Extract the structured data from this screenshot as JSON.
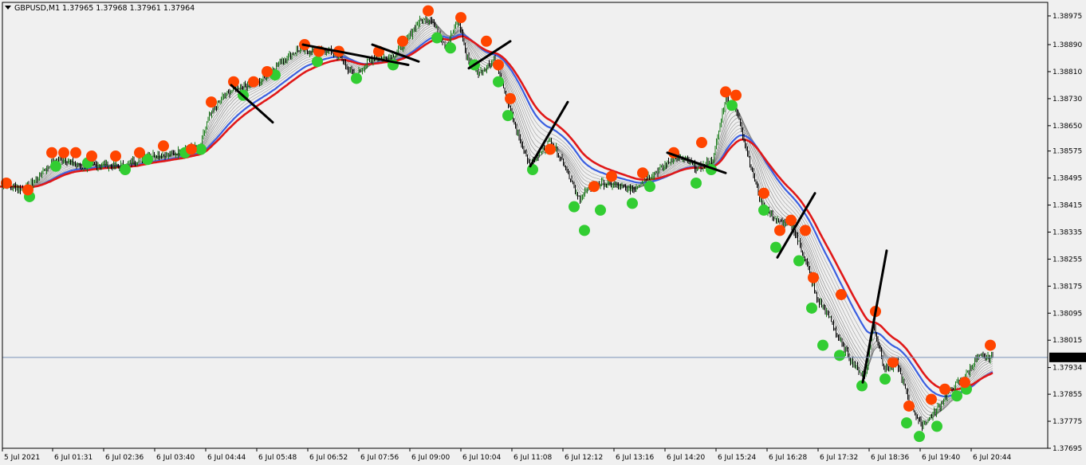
{
  "header": {
    "symbol_label": "GBPUSD,M1",
    "ohlc_text": "1.37965 1.37968 1.37961 1.37964"
  },
  "chart_data": {
    "type": "candlestick",
    "symbol": "GBPUSD",
    "timeframe": "M1",
    "ohlc": {
      "open": 1.37965,
      "high": 1.37968,
      "low": 1.37961,
      "close": 1.37964
    },
    "current_price": 1.37964,
    "current_price_label": "1.37964",
    "ylim": [
      1.37695,
      1.39015
    ],
    "y_ticks": [
      "1.38975",
      "1.38890",
      "1.38810",
      "1.38730",
      "1.38650",
      "1.38575",
      "1.38495",
      "1.38415",
      "1.38335",
      "1.38255",
      "1.38175",
      "1.38095",
      "1.38015",
      "1.37934",
      "1.37855",
      "1.37775",
      "1.37695"
    ],
    "x_ticks": [
      "5 Jul 2021",
      "6 Jul 01:31",
      "6 Jul 02:36",
      "6 Jul 03:40",
      "6 Jul 04:44",
      "6 Jul 05:48",
      "6 Jul 06:52",
      "6 Jul 07:56",
      "6 Jul 09:00",
      "6 Jul 10:04",
      "6 Jul 11:08",
      "6 Jul 12:12",
      "6 Jul 13:16",
      "6 Jul 14:20",
      "6 Jul 15:24",
      "6 Jul 16:28",
      "6 Jul 17:32",
      "6 Jul 18:36",
      "6 Jul 19:40",
      "6 Jul 20:44"
    ],
    "x_range": [
      0,
      1245
    ],
    "price_path": [
      [
        0,
        1.3847
      ],
      [
        30,
        1.3846
      ],
      [
        55,
        1.3852
      ],
      [
        80,
        1.3855
      ],
      [
        110,
        1.3853
      ],
      [
        140,
        1.3853
      ],
      [
        175,
        1.3855
      ],
      [
        210,
        1.3857
      ],
      [
        250,
        1.3858
      ],
      [
        262,
        1.3868
      ],
      [
        280,
        1.3874
      ],
      [
        300,
        1.3876
      ],
      [
        320,
        1.3878
      ],
      [
        345,
        1.3882
      ],
      [
        375,
        1.3888
      ],
      [
        400,
        1.3887
      ],
      [
        425,
        1.3886
      ],
      [
        445,
        1.388
      ],
      [
        465,
        1.3884
      ],
      [
        490,
        1.3886
      ],
      [
        510,
        1.389
      ],
      [
        525,
        1.3895
      ],
      [
        540,
        1.3897
      ],
      [
        560,
        1.3889
      ],
      [
        575,
        1.3896
      ],
      [
        585,
        1.3885
      ],
      [
        600,
        1.3881
      ],
      [
        620,
        1.3885
      ],
      [
        635,
        1.3872
      ],
      [
        650,
        1.3862
      ],
      [
        665,
        1.3854
      ],
      [
        690,
        1.386
      ],
      [
        710,
        1.3853
      ],
      [
        725,
        1.3844
      ],
      [
        745,
        1.3847
      ],
      [
        770,
        1.3848
      ],
      [
        795,
        1.3846
      ],
      [
        820,
        1.3851
      ],
      [
        845,
        1.3856
      ],
      [
        875,
        1.3852
      ],
      [
        895,
        1.3856
      ],
      [
        910,
        1.3873
      ],
      [
        925,
        1.3868
      ],
      [
        940,
        1.3855
      ],
      [
        955,
        1.3842
      ],
      [
        975,
        1.3836
      ],
      [
        995,
        1.3835
      ],
      [
        1010,
        1.3826
      ],
      [
        1025,
        1.3813
      ],
      [
        1040,
        1.3808
      ],
      [
        1055,
        1.3801
      ],
      [
        1075,
        1.3793
      ],
      [
        1085,
        1.379
      ],
      [
        1095,
        1.3806
      ],
      [
        1110,
        1.3793
      ],
      [
        1125,
        1.3795
      ],
      [
        1140,
        1.3783
      ],
      [
        1155,
        1.3776
      ],
      [
        1170,
        1.378
      ],
      [
        1190,
        1.3786
      ],
      [
        1210,
        1.379
      ],
      [
        1225,
        1.3797
      ],
      [
        1245,
        1.37964
      ]
    ],
    "markers": {
      "orange": [
        [
          8,
          1.3848
        ],
        [
          35,
          1.3846
        ],
        [
          65,
          1.3857
        ],
        [
          80,
          1.3857
        ],
        [
          95,
          1.3857
        ],
        [
          115,
          1.3856
        ],
        [
          145,
          1.3856
        ],
        [
          175,
          1.3857
        ],
        [
          205,
          1.3859
        ],
        [
          240,
          1.3858
        ],
        [
          265,
          1.3872
        ],
        [
          293,
          1.3878
        ],
        [
          318,
          1.3878
        ],
        [
          335,
          1.3881
        ],
        [
          382,
          1.3889
        ],
        [
          400,
          1.3887
        ],
        [
          425,
          1.3887
        ],
        [
          475,
          1.3887
        ],
        [
          505,
          1.389
        ],
        [
          537,
          1.3899
        ],
        [
          578,
          1.3897
        ],
        [
          610,
          1.389
        ],
        [
          625,
          1.3883
        ],
        [
          640,
          1.3873
        ],
        [
          690,
          1.3858
        ],
        [
          745,
          1.3847
        ],
        [
          767,
          1.385
        ],
        [
          806,
          1.3851
        ],
        [
          845,
          1.3857
        ],
        [
          880,
          1.386
        ],
        [
          910,
          1.3875
        ],
        [
          923,
          1.3874
        ],
        [
          958,
          1.3845
        ],
        [
          978,
          1.3834
        ],
        [
          992,
          1.3837
        ],
        [
          1010,
          1.3834
        ],
        [
          1020,
          1.382
        ],
        [
          1055,
          1.3815
        ],
        [
          1098,
          1.381
        ],
        [
          1120,
          1.3795
        ],
        [
          1140,
          1.3782
        ],
        [
          1168,
          1.3784
        ],
        [
          1185,
          1.3787
        ],
        [
          1210,
          1.3789
        ],
        [
          1242,
          1.38
        ]
      ],
      "green": [
        [
          37,
          1.3844
        ],
        [
          70,
          1.3853
        ],
        [
          110,
          1.3854
        ],
        [
          157,
          1.3852
        ],
        [
          185,
          1.3855
        ],
        [
          232,
          1.3857
        ],
        [
          252,
          1.3858
        ],
        [
          305,
          1.3874
        ],
        [
          345,
          1.388
        ],
        [
          398,
          1.3884
        ],
        [
          447,
          1.3879
        ],
        [
          493,
          1.3883
        ],
        [
          548,
          1.3891
        ],
        [
          565,
          1.3888
        ],
        [
          595,
          1.3883
        ],
        [
          625,
          1.3878
        ],
        [
          637,
          1.3868
        ],
        [
          668,
          1.3852
        ],
        [
          720,
          1.3841
        ],
        [
          733,
          1.3834
        ],
        [
          753,
          1.384
        ],
        [
          793,
          1.3842
        ],
        [
          815,
          1.3847
        ],
        [
          873,
          1.3848
        ],
        [
          892,
          1.3852
        ],
        [
          918,
          1.3871
        ],
        [
          958,
          1.384
        ],
        [
          973,
          1.3829
        ],
        [
          1002,
          1.3825
        ],
        [
          1018,
          1.3811
        ],
        [
          1032,
          1.38
        ],
        [
          1053,
          1.3797
        ],
        [
          1081,
          1.3788
        ],
        [
          1110,
          1.379
        ],
        [
          1137,
          1.3777
        ],
        [
          1153,
          1.3773
        ],
        [
          1175,
          1.3776
        ],
        [
          1200,
          1.3785
        ],
        [
          1212,
          1.3787
        ]
      ]
    },
    "trendlines": [
      [
        [
          290,
          1.3877
        ],
        [
          342,
          1.3866
        ]
      ],
      [
        [
          380,
          1.3889
        ],
        [
          512,
          1.3883
        ]
      ],
      [
        [
          467,
          1.3889
        ],
        [
          525,
          1.3884
        ]
      ],
      [
        [
          588,
          1.3882
        ],
        [
          640,
          1.389
        ]
      ],
      [
        [
          665,
          1.3853
        ],
        [
          712,
          1.3872
        ]
      ],
      [
        [
          837,
          1.3857
        ],
        [
          910,
          1.3851
        ]
      ],
      [
        [
          975,
          1.3826
        ],
        [
          1022,
          1.3845
        ]
      ],
      [
        [
          1082,
          1.3789
        ],
        [
          1112,
          1.3828
        ]
      ]
    ]
  }
}
